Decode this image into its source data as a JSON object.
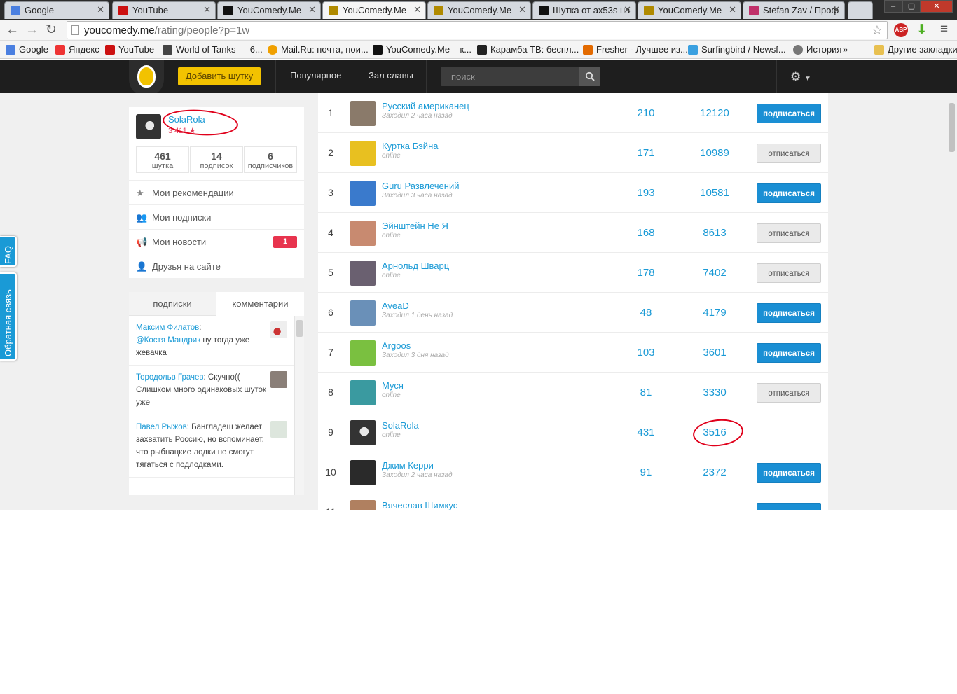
{
  "browser": {
    "tabs": [
      {
        "title": "Google",
        "active": false
      },
      {
        "title": "YouTube",
        "active": false
      },
      {
        "title": "YouComedy.Me –",
        "active": false
      },
      {
        "title": "YouComedy.Me –",
        "active": true
      },
      {
        "title": "YouComedy.Me –",
        "active": false
      },
      {
        "title": "Шутка от ax53s на",
        "active": false
      },
      {
        "title": "YouComedy.Me –",
        "active": false
      },
      {
        "title": "Stefan Zav / Проф",
        "active": false
      }
    ],
    "url_domain": "youcomedy.me",
    "url_path": "/rating/people?p=1w",
    "bookmarks": [
      "Google",
      "Яндекс",
      "YouTube",
      "World of Tanks — 6...",
      "Mail.Ru: почта, пои...",
      "YouComedy.Me – к...",
      "Карамба ТВ: беспл...",
      "Fresher - Лучшее из...",
      "Surfingbird / Newsf...",
      "История",
      "»",
      "Другие закладки"
    ]
  },
  "site": {
    "add_joke": "Добавить шутку",
    "nav": [
      "Популярное",
      "Зал славы"
    ],
    "search_placeholder": "поиск"
  },
  "side_tabs": {
    "faq": "FAQ",
    "feedback": "Обратная связь"
  },
  "profile": {
    "username": "SolaRola",
    "rating": "3 411",
    "stats": [
      {
        "num": "461",
        "label": "шутка"
      },
      {
        "num": "14",
        "label": "подписок"
      },
      {
        "num": "6",
        "label": "подписчиков"
      }
    ]
  },
  "menu": [
    {
      "label": "Мои рекомендации",
      "icon": "star-icon"
    },
    {
      "label": "Мои подписки",
      "icon": "users-icon"
    },
    {
      "label": "Мои новости",
      "icon": "megaphone-icon",
      "badge": "1"
    },
    {
      "label": "Друзья на сайте",
      "icon": "user-icon"
    }
  ],
  "comment_tabs": [
    "подписки",
    "комментарии"
  ],
  "comments": [
    {
      "author": "Максим Филатов",
      "mention": "@Костя Мандрик",
      "text": " ну тогда уже жевачка"
    },
    {
      "author": "Тородольв Грачев",
      "mention": "",
      "text": ": Скучно(( Слишком много одинаковых шуток уже"
    },
    {
      "author": "Павел Рыжов",
      "mention": "",
      "text": ": Бангладеш желает захватить Россию, но вспоминает, что рыбнацкие лодки не смогут тягаться с подлодками."
    }
  ],
  "rating": [
    {
      "pos": "1",
      "name": "Русский американец",
      "seen": "Заходил 2 часа назад",
      "v1": "210",
      "v2": "12120",
      "button": "подписаться",
      "color": "#8a7a6a"
    },
    {
      "pos": "2",
      "name": "Куртка Бэйна",
      "seen": "online",
      "v1": "171",
      "v2": "10989",
      "button": "отписаться",
      "color": "#e8c020"
    },
    {
      "pos": "3",
      "name": "Guru Развлечений",
      "seen": "Заходил 3 часа назад",
      "v1": "193",
      "v2": "10581",
      "button": "подписаться",
      "color": "#3a7acc"
    },
    {
      "pos": "4",
      "name": "Эйнштейн Не Я",
      "seen": "online",
      "v1": "168",
      "v2": "8613",
      "button": "отписаться",
      "color": "#c88a70"
    },
    {
      "pos": "5",
      "name": "Арнольд Шварц",
      "seen": "online",
      "v1": "178",
      "v2": "7402",
      "button": "отписаться",
      "color": "#6a6070"
    },
    {
      "pos": "6",
      "name": "AveaD",
      "seen": "Заходил 1 день назад",
      "v1": "48",
      "v2": "4179",
      "button": "подписаться",
      "color": "#6a90b8"
    },
    {
      "pos": "7",
      "name": "Argoos",
      "seen": "Заходил 3 дня назад",
      "v1": "103",
      "v2": "3601",
      "button": "подписаться",
      "color": "#7ac040"
    },
    {
      "pos": "8",
      "name": "Муся",
      "seen": "online",
      "v1": "81",
      "v2": "3330",
      "button": "отписаться",
      "color": "#3a9aa0"
    },
    {
      "pos": "9",
      "name": "SolaRola",
      "seen": "online",
      "v1": "431",
      "v2": "3516",
      "button": "",
      "color": "#333333"
    },
    {
      "pos": "10",
      "name": "Джим Керри",
      "seen": "Заходил 2 часа назад",
      "v1": "91",
      "v2": "2372",
      "button": "подписаться",
      "color": "#2a2a2a"
    },
    {
      "pos": "11",
      "name": "Вячеслав Шимкус",
      "seen": "",
      "v1": "",
      "v2": "",
      "button": "подписаться",
      "color": "#b08060"
    }
  ]
}
